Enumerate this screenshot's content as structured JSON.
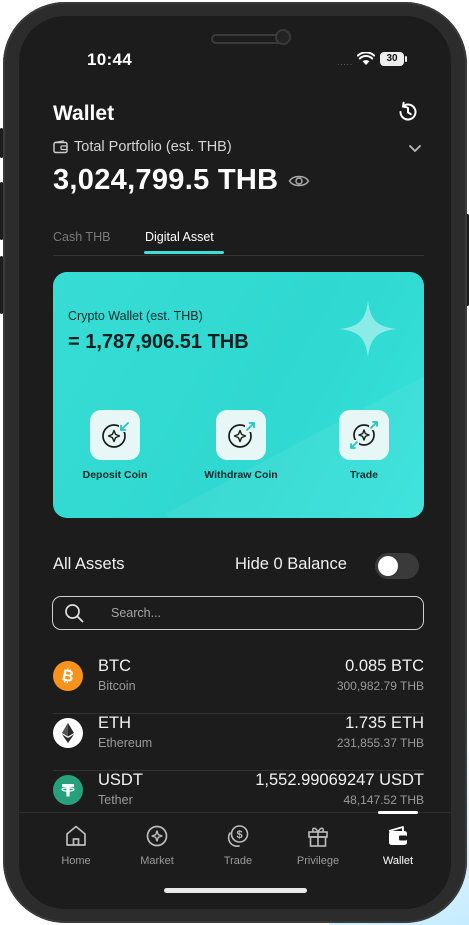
{
  "status_bar": {
    "time": "10:44",
    "signal": ".....",
    "battery": "30"
  },
  "header": {
    "title": "Wallet",
    "portfolio_label": "Total Portfolio (est. THB)",
    "balance": "3,024,799.5 THB"
  },
  "tabs": [
    {
      "label": "Cash THB",
      "active": false
    },
    {
      "label": "Digital Asset",
      "active": true
    }
  ],
  "crypto_card": {
    "label": "Crypto Wallet (est. THB)",
    "value": "= 1,787,906.51 THB",
    "actions": [
      {
        "label": "Deposit Coin",
        "icon": "deposit-coin-icon"
      },
      {
        "label": "Withdraw Coin",
        "icon": "withdraw-coin-icon"
      },
      {
        "label": "Trade",
        "icon": "trade-icon"
      }
    ]
  },
  "assets_section": {
    "title": "All Assets",
    "hide_zero_label": "Hide 0 Balance",
    "hide_zero_enabled": false
  },
  "search": {
    "placeholder": "Search...",
    "value": ""
  },
  "assets": [
    {
      "symbol": "BTC",
      "name": "Bitcoin",
      "amount": "0.085 BTC",
      "thb": "300,982.79 THB",
      "icon": "bitcoin-icon",
      "color": "#f7931a"
    },
    {
      "symbol": "ETH",
      "name": "Ethereum",
      "amount": "1.735 ETH",
      "thb": "231,855.37 THB",
      "icon": "ethereum-icon",
      "color": "#ffffff"
    },
    {
      "symbol": "USDT",
      "name": "Tether",
      "amount": "1,552.99069247 USDT",
      "thb": "48,147.52 THB",
      "icon": "tether-icon",
      "color": "#26a17b"
    }
  ],
  "nav": [
    {
      "label": "Home",
      "icon": "home-icon",
      "active": false
    },
    {
      "label": "Market",
      "icon": "market-icon",
      "active": false
    },
    {
      "label": "Trade",
      "icon": "trade-coin-icon",
      "active": false
    },
    {
      "label": "Privilege",
      "icon": "gift-icon",
      "active": false
    },
    {
      "label": "Wallet",
      "icon": "wallet-icon",
      "active": true
    }
  ],
  "colors": {
    "accent": "#3de0d6",
    "card": "#2fd8d0",
    "background": "#1c1c1c"
  }
}
